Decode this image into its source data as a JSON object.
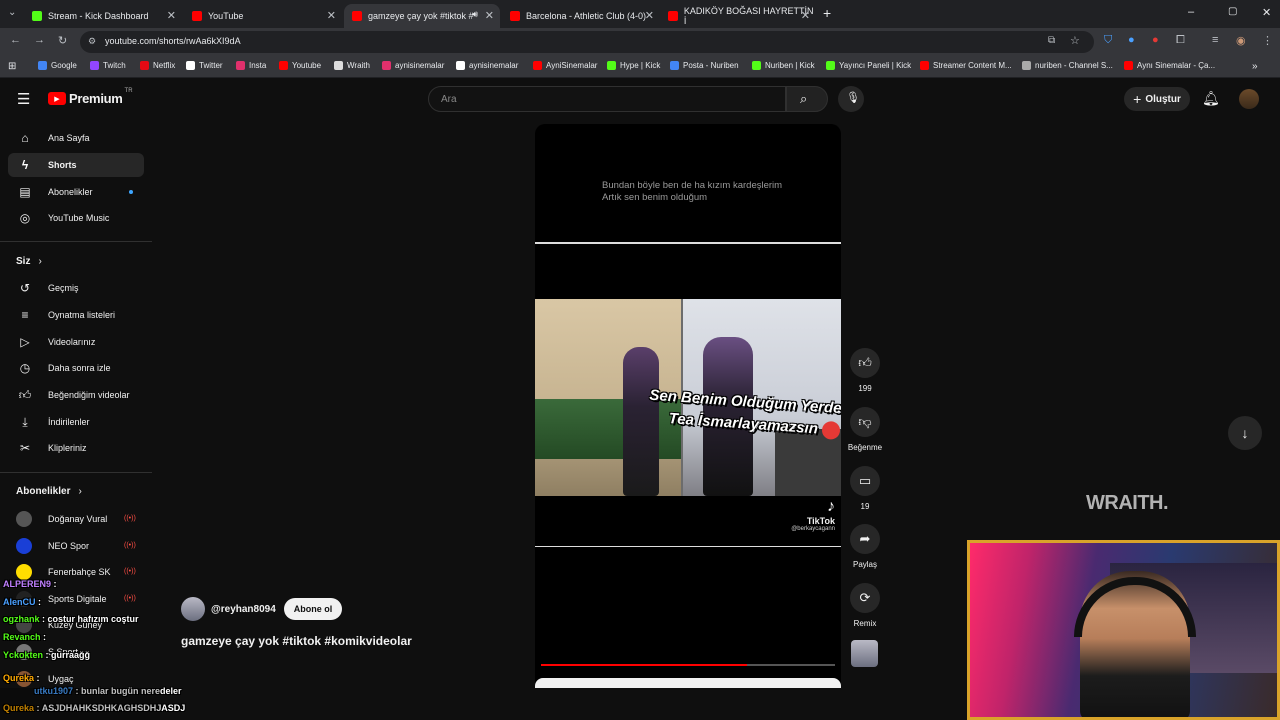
{
  "browser": {
    "tabs": [
      {
        "label": "Stream - Kick Dashboard",
        "color": "#53fc18"
      },
      {
        "label": "YouTube",
        "color": "#ff0000"
      },
      {
        "label": "gamzeye çay yok #tiktok #",
        "color": "#ff0000",
        "active": true
      },
      {
        "label": "Barcelona - Athletic Club (4-0)",
        "color": "#ff0000"
      },
      {
        "label": "KADIKÖY BOĞASI HAYRETTİN İ",
        "color": "#ff0000"
      }
    ],
    "url": "youtube.com/shorts/rwAa6kXI9dA",
    "bookmarks": [
      {
        "label": "Google",
        "color": "#4285f4"
      },
      {
        "label": "Twitch",
        "color": "#9146ff"
      },
      {
        "label": "Netflix",
        "color": "#e50914"
      },
      {
        "label": "Twitter",
        "color": "#ffffff"
      },
      {
        "label": "Insta",
        "color": "#e1306c"
      },
      {
        "label": "Youtube",
        "color": "#ff0000"
      },
      {
        "label": "Wraith",
        "color": "#dddddd"
      },
      {
        "label": "aynisinemalar",
        "color": "#e1306c"
      },
      {
        "label": "aynisinemalar",
        "color": "#ffffff"
      },
      {
        "label": "AyniSinemalar",
        "color": "#ff0000"
      },
      {
        "label": "Hype | Kick",
        "color": "#53fc18"
      },
      {
        "label": "Posta - Nuriben",
        "color": "#4285f4"
      },
      {
        "label": "Nuriben | Kick",
        "color": "#53fc18"
      },
      {
        "label": "Yayıncı Paneli | Kick",
        "color": "#53fc18"
      },
      {
        "label": "Streamer Content M...",
        "color": "#ff0000"
      },
      {
        "label": "nuriben - Channel S...",
        "color": "#aaaaaa"
      },
      {
        "label": "Aynı Sinemalar - Ça...",
        "color": "#ff0000"
      }
    ]
  },
  "header": {
    "logo_text": "Premium",
    "logo_region": "TR",
    "search_placeholder": "Ara",
    "create_label": "Oluştur"
  },
  "sidebar": {
    "main": [
      {
        "label": "Ana Sayfa",
        "icon": "home-icon"
      },
      {
        "label": "Shorts",
        "icon": "shorts-icon",
        "active": true
      },
      {
        "label": "Abonelikler",
        "icon": "subscriptions-icon",
        "dot": true
      },
      {
        "label": "YouTube Music",
        "icon": "music-icon"
      }
    ],
    "you_title": "Siz",
    "you": [
      {
        "label": "Geçmiş",
        "icon": "history-icon"
      },
      {
        "label": "Oynatma listeleri",
        "icon": "playlist-icon"
      },
      {
        "label": "Videolarınız",
        "icon": "your-videos-icon"
      },
      {
        "label": "Daha sonra izle",
        "icon": "watch-later-icon"
      },
      {
        "label": "Beğendiğim videolar",
        "icon": "like-icon"
      },
      {
        "label": "İndirilenler",
        "icon": "download-icon"
      },
      {
        "label": "Klipleriniz",
        "icon": "clips-icon"
      }
    ],
    "subs_title": "Abonelikler",
    "subs": [
      {
        "label": "Doğanay Vural",
        "color": "#555555"
      },
      {
        "label": "NEO Spor",
        "color": "#1a3fd6"
      },
      {
        "label": "Fenerbahçe SK",
        "color": "#ffdd00"
      },
      {
        "label": "Sports Digitale",
        "color": "#222222"
      },
      {
        "label": "Kuzey Güney",
        "color": "#444444"
      },
      {
        "label": "S Sport",
        "color": "#777777"
      },
      {
        "label": "Uygaç",
        "color": "#885533"
      }
    ]
  },
  "chat": [
    {
      "user": "ALPEREN9",
      "msg": "",
      "color": "#c080ff"
    },
    {
      "user": "AlenCU",
      "msg": "",
      "color": "#4aa0ff"
    },
    {
      "user": "ogzhank",
      "msg": "costur hafızım coştur",
      "color": "#53fc18"
    },
    {
      "user": "Revanch",
      "msg": "",
      "color": "#53fc18"
    },
    {
      "user": "Yckokten",
      "msg": "gurraağğ",
      "color": "#53fc18"
    },
    {
      "user": "Qureka",
      "msg": "",
      "color": "#ffaa00"
    },
    {
      "user": "utku1907",
      "msg": "bunlar bugün neredeler",
      "color": "#4aa0ff"
    },
    {
      "user": "Qureka",
      "msg": "ASJDHAHKSDHKAGHSDHJASDJ",
      "color": "#ffaa00"
    }
  ],
  "short": {
    "caption_line1": "Bundan böyle ben de ha kızım kardeşlerim",
    "caption_line2": "Artık sen benim olduğum",
    "overlay_line1": "Sen Benim Olduğum Yerde",
    "overlay_line2": "Tea İsmarlayamazsın",
    "tiktok_label": "TikTok",
    "tiktok_handle": "@berkaycagann",
    "channel": "@reyhan8094",
    "subscribe_label": "Abone ol",
    "title": "gamzeye çay yok #tiktok #komikvideolar",
    "progress": 0.7
  },
  "actions": {
    "like_count": "199",
    "dislike_label": "Beğenme",
    "comment_count": "19",
    "share_label": "Paylaş",
    "remix_label": "Remix"
  },
  "stream_overlay": {
    "watermark": "WRAITH."
  }
}
